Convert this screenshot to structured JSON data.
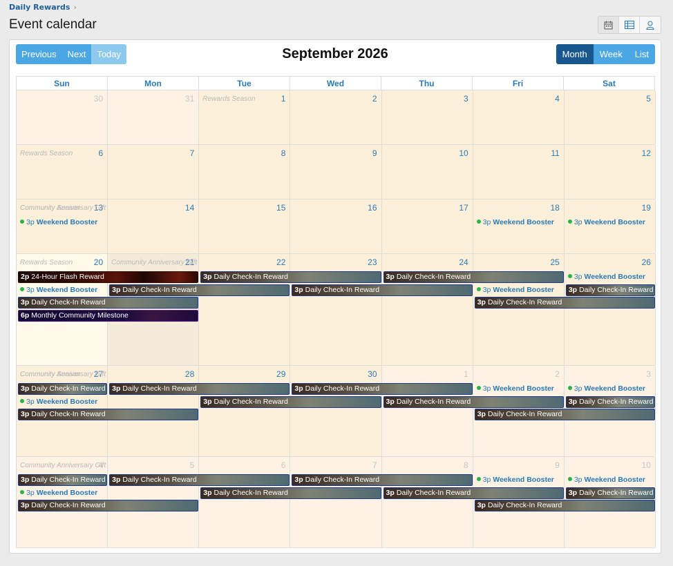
{
  "breadcrumb": {
    "label": "Daily Rewards",
    "separator": "›"
  },
  "page_title": "Event calendar",
  "view_switch": [
    {
      "icon": "calendar-icon"
    },
    {
      "icon": "table-icon"
    },
    {
      "icon": "user-icon"
    }
  ],
  "toolbar": {
    "prev_label": "Previous",
    "next_label": "Next",
    "today_label": "Today",
    "title": "September 2026",
    "month_label": "Month",
    "week_label": "Week",
    "list_label": "List"
  },
  "weekdays": [
    "Sun",
    "Mon",
    "Tue",
    "Wed",
    "Thu",
    "Fri",
    "Sat"
  ],
  "colors": {
    "accent": "#4aa7e4",
    "accent_dark": "#17578e",
    "day_bg": "#fdf0da",
    "today_bg": "#fff9ea",
    "dot": "#2bb34a",
    "link": "#2a79b5"
  },
  "weeks": [
    {
      "days": [
        {
          "num": "30",
          "other": true
        },
        {
          "num": "31",
          "other": true
        },
        {
          "num": "1",
          "season": "Rewards Season"
        },
        {
          "num": "2"
        },
        {
          "num": "3"
        },
        {
          "num": "4"
        },
        {
          "num": "5"
        }
      ],
      "bars": [],
      "dots": []
    },
    {
      "days": [
        {
          "num": "6",
          "season": "Rewards Season"
        },
        {
          "num": "7"
        },
        {
          "num": "8"
        },
        {
          "num": "9"
        },
        {
          "num": "10"
        },
        {
          "num": "11"
        },
        {
          "num": "12"
        }
      ],
      "bars": [],
      "dots": []
    },
    {
      "days": [
        {
          "num": "13",
          "season": "Community Season",
          "season2": "Community Anniversary Gift"
        },
        {
          "num": "14"
        },
        {
          "num": "15"
        },
        {
          "num": "16"
        },
        {
          "num": "17"
        },
        {
          "num": "18"
        },
        {
          "num": "19"
        }
      ],
      "bars": [],
      "dots": [
        {
          "col": 0,
          "row": 0,
          "time": "3p",
          "title": "Weekend Booster"
        },
        {
          "col": 5,
          "row": 0,
          "time": "3p",
          "title": "Weekend Booster"
        },
        {
          "col": 6,
          "row": 0,
          "time": "3p",
          "title": "Weekend Booster"
        }
      ]
    },
    {
      "days": [
        {
          "num": "20",
          "season": "Rewards Season",
          "today": true
        },
        {
          "num": "21",
          "season": "Community Anniversary Gift",
          "shade": true
        },
        {
          "num": "22"
        },
        {
          "num": "23"
        },
        {
          "num": "24"
        },
        {
          "num": "25"
        },
        {
          "num": "26"
        }
      ],
      "bars": [
        {
          "col": 0,
          "span": 2,
          "row": 0,
          "time": "2p",
          "title": "24-Hour Flash Reward",
          "kind": "flash"
        },
        {
          "col": 2,
          "span": 2,
          "row": 0,
          "time": "3p",
          "title": "Daily Check-In Reward",
          "kind": "checkin"
        },
        {
          "col": 4,
          "span": 2,
          "row": 0,
          "time": "3p",
          "title": "Daily Check-In Reward",
          "kind": "checkin"
        },
        {
          "col": 1,
          "span": 2,
          "row": 1,
          "time": "3p",
          "title": "Daily Check-In Reward",
          "kind": "checkin"
        },
        {
          "col": 3,
          "span": 2,
          "row": 1,
          "time": "3p",
          "title": "Daily Check-In Reward",
          "kind": "checkin"
        },
        {
          "col": 6,
          "span": 1,
          "row": 1,
          "time": "3p",
          "title": "Daily Check-In Reward",
          "kind": "checkin"
        },
        {
          "col": 0,
          "span": 2,
          "row": 2,
          "time": "3p",
          "title": "Daily Check-In Reward",
          "kind": "checkin"
        },
        {
          "col": 5,
          "span": 2,
          "row": 2,
          "time": "3p",
          "title": "Daily Check-In Reward",
          "kind": "checkin"
        },
        {
          "col": 0,
          "span": 2,
          "row": 3,
          "time": "6p",
          "title": "Monthly Community Milestone",
          "kind": "milestone"
        }
      ],
      "dots": [
        {
          "col": 6,
          "row": 0,
          "time": "3p",
          "title": "Weekend Booster"
        },
        {
          "col": 0,
          "row": 1,
          "time": "3p",
          "title": "Weekend Booster"
        },
        {
          "col": 5,
          "row": 1,
          "time": "3p",
          "title": "Weekend Booster"
        }
      ]
    },
    {
      "days": [
        {
          "num": "27",
          "season": "Community Season",
          "season2": "Community Anniversary Gift"
        },
        {
          "num": "28"
        },
        {
          "num": "29"
        },
        {
          "num": "30"
        },
        {
          "num": "1",
          "other": true
        },
        {
          "num": "2",
          "other": true
        },
        {
          "num": "3",
          "other": true
        }
      ],
      "bars": [
        {
          "col": 0,
          "span": 1,
          "row": 0,
          "time": "3p",
          "title": "Daily Check-In Reward",
          "kind": "checkin"
        },
        {
          "col": 1,
          "span": 2,
          "row": 0,
          "time": "3p",
          "title": "Daily Check-In Reward",
          "kind": "checkin"
        },
        {
          "col": 3,
          "span": 2,
          "row": 0,
          "time": "3p",
          "title": "Daily Check-In Reward",
          "kind": "checkin"
        },
        {
          "col": 2,
          "span": 2,
          "row": 1,
          "time": "3p",
          "title": "Daily Check-In Reward",
          "kind": "checkin"
        },
        {
          "col": 4,
          "span": 2,
          "row": 1,
          "time": "3p",
          "title": "Daily Check-In Reward",
          "kind": "checkin"
        },
        {
          "col": 6,
          "span": 1,
          "row": 1,
          "time": "3p",
          "title": "Daily Check-In Reward",
          "kind": "checkin"
        },
        {
          "col": 0,
          "span": 2,
          "row": 2,
          "time": "3p",
          "title": "Daily Check-In Reward",
          "kind": "checkin"
        },
        {
          "col": 5,
          "span": 2,
          "row": 2,
          "time": "3p",
          "title": "Daily Check-In Reward",
          "kind": "checkin"
        }
      ],
      "dots": [
        {
          "col": 5,
          "row": 0,
          "time": "3p",
          "title": "Weekend Booster"
        },
        {
          "col": 6,
          "row": 0,
          "time": "3p",
          "title": "Weekend Booster"
        },
        {
          "col": 0,
          "row": 1,
          "time": "3p",
          "title": "Weekend Booster"
        }
      ]
    },
    {
      "days": [
        {
          "num": "4",
          "other": true,
          "season": "Community Anniversary Gift"
        },
        {
          "num": "5",
          "other": true
        },
        {
          "num": "6",
          "other": true
        },
        {
          "num": "7",
          "other": true
        },
        {
          "num": "8",
          "other": true
        },
        {
          "num": "9",
          "other": true
        },
        {
          "num": "10",
          "other": true
        }
      ],
      "bars": [
        {
          "col": 0,
          "span": 1,
          "row": 0,
          "time": "3p",
          "title": "Daily Check-In Reward",
          "kind": "checkin"
        },
        {
          "col": 1,
          "span": 2,
          "row": 0,
          "time": "3p",
          "title": "Daily Check-In Reward",
          "kind": "checkin"
        },
        {
          "col": 3,
          "span": 2,
          "row": 0,
          "time": "3p",
          "title": "Daily Check-In Reward",
          "kind": "checkin"
        },
        {
          "col": 2,
          "span": 2,
          "row": 1,
          "time": "3p",
          "title": "Daily Check-In Reward",
          "kind": "checkin"
        },
        {
          "col": 4,
          "span": 2,
          "row": 1,
          "time": "3p",
          "title": "Daily Check-In Reward",
          "kind": "checkin"
        },
        {
          "col": 6,
          "span": 1,
          "row": 1,
          "time": "3p",
          "title": "Daily Check-In Reward",
          "kind": "checkin"
        },
        {
          "col": 0,
          "span": 2,
          "row": 2,
          "time": "3p",
          "title": "Daily Check-In Reward",
          "kind": "checkin"
        },
        {
          "col": 5,
          "span": 2,
          "row": 2,
          "time": "3p",
          "title": "Daily Check-In Reward",
          "kind": "checkin"
        }
      ],
      "dots": [
        {
          "col": 5,
          "row": 0,
          "time": "3p",
          "title": "Weekend Booster"
        },
        {
          "col": 6,
          "row": 0,
          "time": "3p",
          "title": "Weekend Booster"
        },
        {
          "col": 0,
          "row": 1,
          "time": "3p",
          "title": "Weekend Booster"
        }
      ]
    }
  ]
}
